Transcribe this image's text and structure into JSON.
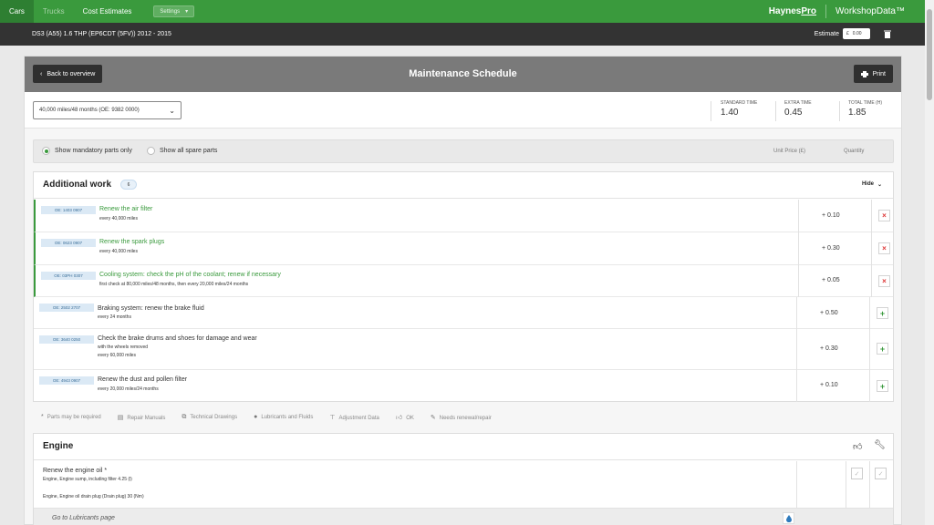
{
  "topnav": {
    "items": [
      "Cars",
      "Trucks",
      "Cost Estimates"
    ],
    "settings_label": "Settings",
    "brand_haynes_1": "Haynes",
    "brand_haynes_2": "Pro",
    "brand_workshop": "WorkshopData™"
  },
  "vehicle": {
    "title": "DS3 (A55) 1.6 THP (EP6CDT (5FV)) 2012 - 2015",
    "estimate_label": "Estimate",
    "estimate_currency": "£",
    "estimate_value": "0.00"
  },
  "page": {
    "back_label": "Back to overview",
    "title": "Maintenance Schedule",
    "print_label": "Print"
  },
  "interval": {
    "selected": "40,000 miles/48 months (OE: 9382 0000)",
    "times": [
      {
        "label": "STANDARD TIME",
        "value": "1.40"
      },
      {
        "label": "EXTRA TIME",
        "value": "0.45"
      },
      {
        "label": "TOTAL TIME (H)",
        "value": "1.85"
      }
    ]
  },
  "filter": {
    "opt1": "Show mandatory parts only",
    "opt2": "Show all spare parts",
    "col_price": "Unit Price (£)",
    "col_qty": "Quantity"
  },
  "additional": {
    "title": "Additional work",
    "count": "6",
    "hide_label": "Hide",
    "rows": [
      {
        "oe": "OE: 1403 0907",
        "title": "Renew the air filter",
        "sub": [
          "every 40,000 miles"
        ],
        "time": "+ 0.10",
        "selected": true
      },
      {
        "oe": "OE: 0623 0907",
        "title": "Renew the spark plugs",
        "sub": [
          "every 40,000 miles"
        ],
        "time": "+ 0.30",
        "selected": true
      },
      {
        "oe": "OE: 03PH 0307",
        "title": "Cooling system: check the pH of the coolant; renew if necessary",
        "sub": [
          "first check at 80,000 miles/48 months, then every 20,000 miles/24 months"
        ],
        "time": "+ 0.05",
        "selected": true
      },
      {
        "oe": "OE: 2502 2707",
        "title": "Braking system: renew the brake fluid",
        "sub": [
          "every 24 months"
        ],
        "time": "+ 0.50",
        "selected": false
      },
      {
        "oe": "OE: 3640 0250",
        "title": "Check the brake drums and shoes for damage and wear",
        "sub": [
          "with the wheels removed",
          "every 60,000 miles"
        ],
        "time": "+ 0.30",
        "selected": false
      },
      {
        "oe": "OE: 4943 0907",
        "title": "Renew the dust and pollen filter",
        "sub": [
          "every 20,000 miles/24 months"
        ],
        "time": "+ 0.10",
        "selected": false
      }
    ]
  },
  "legend": [
    "Parts may be required",
    "Repair Manuals",
    "Technical Drawings",
    "Lubricants and Fluids",
    "Adjustment Data",
    "OK",
    "Needs renewal/repair"
  ],
  "engine": {
    "title": "Engine",
    "task_title": "Renew the engine oil *",
    "line1": "Engine,  Engine sump, including filter  4.25 (l)",
    "line2": "Engine,  Engine oil drain plug (Drain plug) 30 (Nm)",
    "footer": "Go to Lubricants page"
  },
  "colors": {
    "green": "#3a9a3d",
    "dark": "#333333",
    "remove": "#dd3333"
  }
}
